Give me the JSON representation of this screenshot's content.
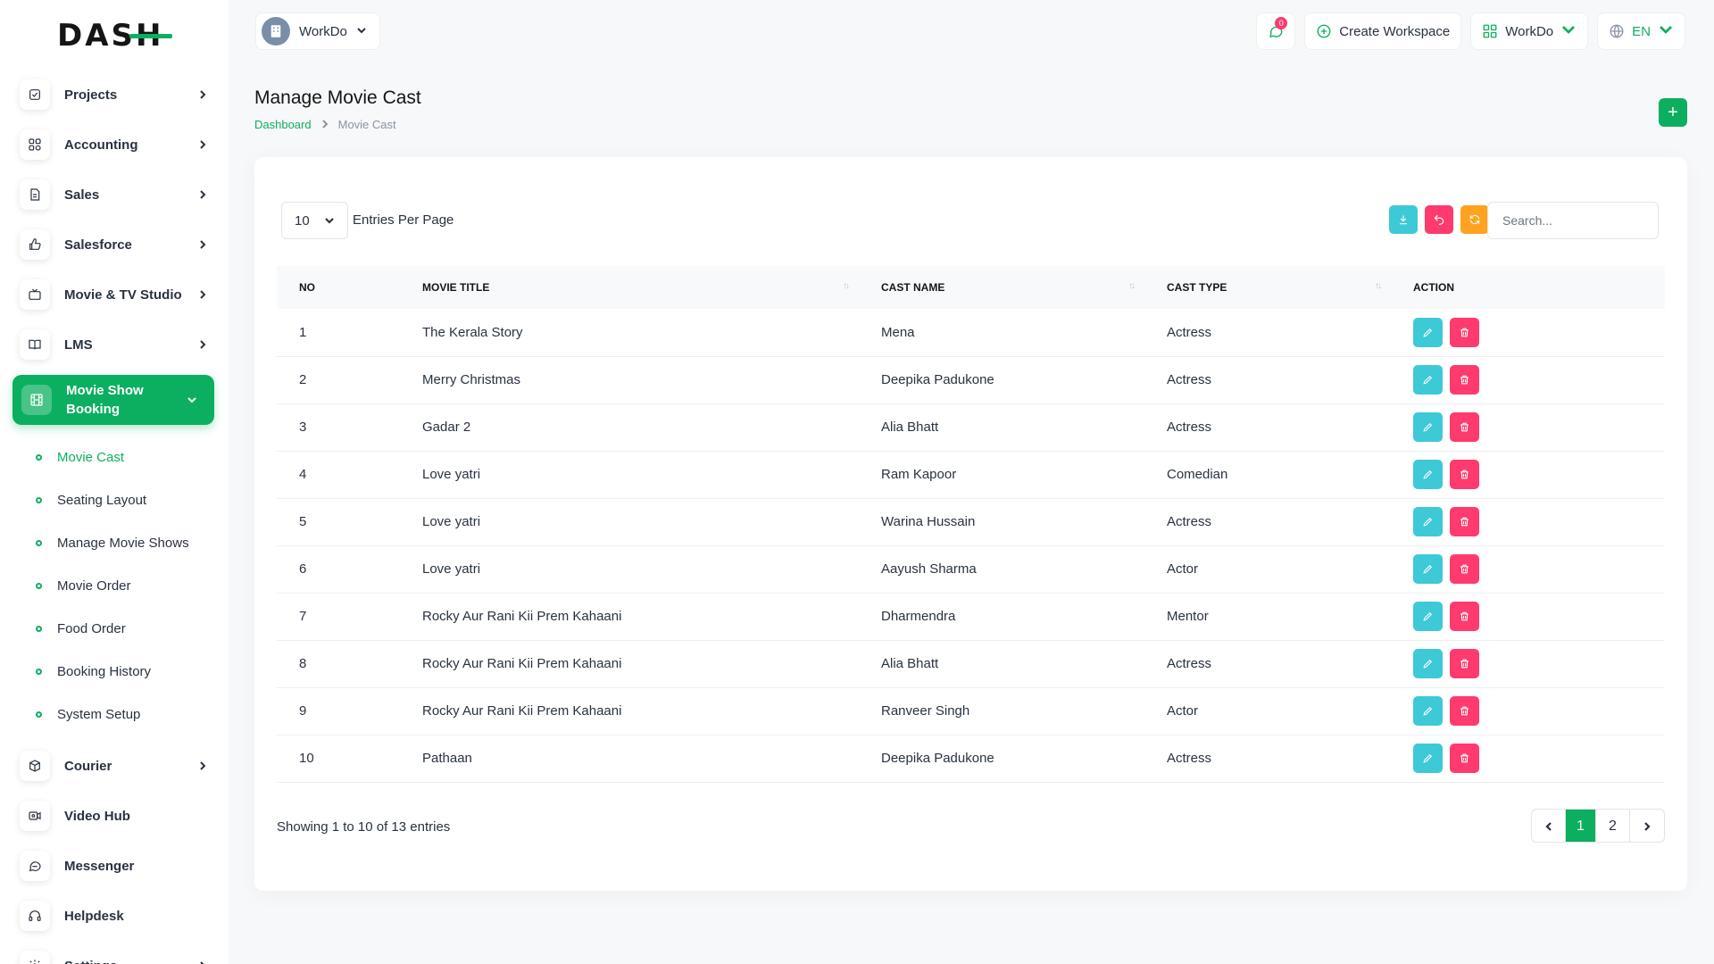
{
  "brand": {
    "logo_text": "DASH",
    "accent": "#0caf60"
  },
  "sidebar": {
    "items": [
      {
        "label": "Projects",
        "icon": "checklist-icon"
      },
      {
        "label": "Accounting",
        "icon": "grid-icon"
      },
      {
        "label": "Sales",
        "icon": "file-icon"
      },
      {
        "label": "Salesforce",
        "icon": "thumb-up-icon"
      },
      {
        "label": "Movie & TV Studio",
        "icon": "tv-icon"
      },
      {
        "label": "LMS",
        "icon": "book-icon"
      }
    ],
    "active": {
      "label": "Movie Show Booking",
      "icon": "film-icon"
    },
    "sub_items": [
      {
        "label": "Movie Cast",
        "active": true
      },
      {
        "label": "Seating Layout"
      },
      {
        "label": "Manage Movie Shows"
      },
      {
        "label": "Movie Order"
      },
      {
        "label": "Food Order"
      },
      {
        "label": "Booking History"
      },
      {
        "label": "System Setup"
      }
    ],
    "items_after": [
      {
        "label": "Courier",
        "icon": "box-icon"
      },
      {
        "label": "Video Hub",
        "icon": "video-icon"
      },
      {
        "label": "Messenger",
        "icon": "chat-icon"
      },
      {
        "label": "Helpdesk",
        "icon": "headset-icon"
      },
      {
        "label": "Settings",
        "icon": "gear-icon"
      }
    ]
  },
  "header": {
    "workspace": "WorkDo",
    "notification_count": "0",
    "create_workspace": "Create Workspace",
    "user_workspace": "WorkDo",
    "language": "EN"
  },
  "page": {
    "title": "Manage Movie Cast",
    "breadcrumb": [
      "Dashboard",
      "Movie Cast"
    ],
    "add_label": "+"
  },
  "toolbar": {
    "per_page": "10",
    "per_page_label": "Entries Per Page",
    "search_placeholder": "Search...",
    "colors": {
      "export": "#3ec9d6",
      "import": "#ff3a6e",
      "refresh": "#ffa21d"
    }
  },
  "table": {
    "columns": [
      "NO",
      "MOVIE TITLE",
      "CAST NAME",
      "CAST TYPE",
      "ACTION"
    ],
    "rows": [
      {
        "no": "1",
        "title": "The Kerala Story",
        "cast": "Mena",
        "type": "Actress"
      },
      {
        "no": "2",
        "title": "Merry Christmas",
        "cast": "Deepika Padukone",
        "type": "Actress"
      },
      {
        "no": "3",
        "title": "Gadar 2",
        "cast": "Alia Bhatt",
        "type": "Actress"
      },
      {
        "no": "4",
        "title": "Love yatri",
        "cast": "Ram Kapoor",
        "type": "Comedian"
      },
      {
        "no": "5",
        "title": "Love yatri",
        "cast": "Warina Hussain",
        "type": "Actress"
      },
      {
        "no": "6",
        "title": "Love yatri",
        "cast": "Aayush Sharma",
        "type": "Actor"
      },
      {
        "no": "7",
        "title": "Rocky Aur Rani Kii Prem Kahaani",
        "cast": "Dharmendra",
        "type": "Mentor"
      },
      {
        "no": "8",
        "title": "Rocky Aur Rani Kii Prem Kahaani",
        "cast": "Alia Bhatt",
        "type": "Actress"
      },
      {
        "no": "9",
        "title": "Rocky Aur Rani Kii Prem Kahaani",
        "cast": "Ranveer Singh",
        "type": "Actor"
      },
      {
        "no": "10",
        "title": "Pathaan",
        "cast": "Deepika Padukone",
        "type": "Actress"
      }
    ],
    "action_colors": {
      "edit": "#3ec9d6",
      "delete": "#ff3a6e"
    }
  },
  "footer": {
    "showing": "Showing 1 to 10 of 13 entries",
    "pages": [
      "1",
      "2"
    ],
    "current_page": "1"
  }
}
